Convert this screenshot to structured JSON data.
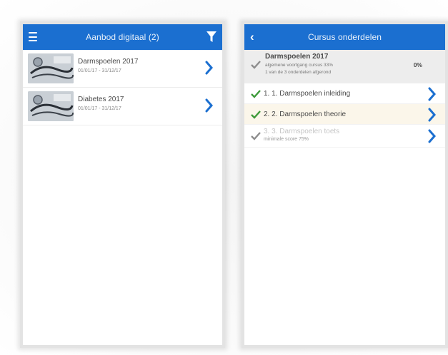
{
  "left_screen": {
    "title": "Aanbod digitaal (2)",
    "menu_icon": "hamburger-menu-icon",
    "filter_icon": "filter-funnel-icon",
    "courses": [
      {
        "name": "Darmspoelen 2017",
        "dates": "01/01/17 - 31/12/17",
        "thumbnail": "stethoscope-image"
      },
      {
        "name": "Diabetes 2017",
        "dates": "01/01/17 - 31/12/17",
        "thumbnail": "stethoscope-image"
      }
    ]
  },
  "right_screen": {
    "title": "Cursus onderdelen",
    "back_icon": "back-chevron-icon",
    "summary": {
      "name": "Darmspoelen 2017",
      "line1": "algemene voortgang cursus 33%",
      "line2": "1 van de 3 onderdelen afgerond",
      "percent": "0%"
    },
    "parts": [
      {
        "label": "1. 1. Darmspoelen inleiding",
        "status": "done",
        "highlighted": false
      },
      {
        "label": "2. 2. Darmspoelen theorie",
        "status": "done",
        "highlighted": true
      },
      {
        "label": "3. 3. Darmspoelen toets",
        "sub": "minimale score 75%",
        "status": "locked",
        "highlighted": false
      }
    ]
  },
  "colors": {
    "header_blue": "#1b6fd0",
    "chevron_blue": "#1b6fd0",
    "check_green": "#3e9a3a",
    "check_grey": "#8d8d8d",
    "highlight_row": "#fbf6ea"
  }
}
